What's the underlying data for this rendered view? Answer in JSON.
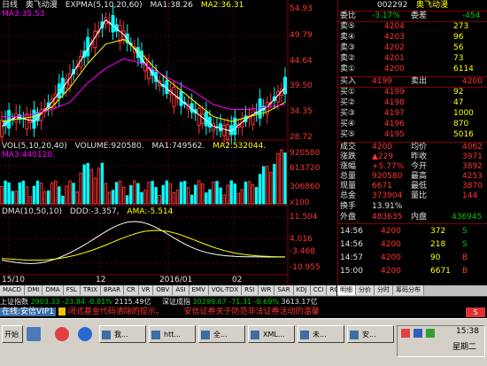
{
  "chart": {
    "stock_prefix": "日线",
    "stock_name": "奥飞动漫",
    "expma_label": "EXPMA(5,10,20,60)",
    "ma1": "MA1:38.26",
    "ma2": "MA2:36.31",
    "ma3": "MA3:35.53",
    "price_ticks": [
      "54.93",
      "49.79",
      "44.64",
      "39.50",
      "34.35",
      "28.72"
    ],
    "vol_label": "VOL(5,10,20,40)",
    "volume": "VOLUME:920580.",
    "vol_ma1": "MA1:749562.",
    "vol_ma2": "MA2:532044.",
    "vol_ma3": "MA3:440120.",
    "vol_ticks": [
      "920580",
      "613720",
      "306860",
      "x100"
    ],
    "dma_label": "DMA(10,50,10)",
    "ddd": "DDD:-3.357,",
    "ama": "AMA:-5.514",
    "dma_ticks": [
      "11.504",
      "4.016",
      "-3.468",
      "-10.955"
    ],
    "date_labels": [
      "15/10",
      "12",
      "2016/01",
      "02"
    ]
  },
  "chart_data": {
    "type": "line",
    "title": "",
    "xlabel": "",
    "ylabel": "",
    "ylim": [
      28.72,
      54.93
    ],
    "x": [
      1,
      5,
      10,
      15,
      20,
      25,
      30,
      35,
      40,
      45,
      50,
      55,
      60,
      65,
      70,
      75,
      80
    ],
    "series": [
      {
        "values": [
          31,
          33,
          32,
          36,
          41,
          47,
          53,
          50,
          45,
          40,
          37,
          34,
          31,
          30,
          33,
          35,
          39
        ]
      },
      {
        "values": [
          32,
          32.5,
          33,
          35,
          39,
          44,
          48,
          49,
          46,
          42,
          39,
          36,
          33,
          32,
          33,
          34,
          36
        ]
      },
      {
        "values": [
          33,
          33,
          33.5,
          34.5,
          36,
          40,
          43,
          45,
          44,
          42,
          40,
          38,
          35.5,
          34.5,
          34.5,
          35,
          35.5
        ]
      }
    ]
  },
  "quote": {
    "code": "002292",
    "name": "奥飞动漫",
    "weibi_label": "委比",
    "weibi": "-3.17%",
    "weicha_label": "委差",
    "weicha": "-454",
    "sells": [
      {
        "label": "卖⑤",
        "price": "4204",
        "vol": "273"
      },
      {
        "label": "卖④",
        "price": "4203",
        "vol": "96"
      },
      {
        "label": "卖③",
        "price": "4202",
        "vol": "56"
      },
      {
        "label": "卖②",
        "price": "4201",
        "vol": "73"
      },
      {
        "label": "卖①",
        "price": "4200",
        "vol": "6114"
      }
    ],
    "buy_in_label": "买入",
    "buy_in": "4199",
    "sell_out_label": "卖出",
    "sell_out": "4200",
    "buys": [
      {
        "label": "买①",
        "price": "4199",
        "vol": "92"
      },
      {
        "label": "买②",
        "price": "4198",
        "vol": "47"
      },
      {
        "label": "买③",
        "price": "4197",
        "vol": "1000"
      },
      {
        "label": "买④",
        "price": "4196",
        "vol": "870"
      },
      {
        "label": "买⑤",
        "price": "4195",
        "vol": "5016"
      }
    ],
    "stats": [
      {
        "l1": "成交",
        "v1": "4200",
        "l2": "均价",
        "v2": "4062"
      },
      {
        "l1": "涨跌",
        "v1": "▲229",
        "l2": "昨收",
        "v2": "3971"
      },
      {
        "l1": "涨幅",
        "v1": "+5.77%",
        "l2": "今开",
        "v2": "3892"
      },
      {
        "l1": "总量",
        "v1": "920580",
        "l2": "最高",
        "v2": "4253"
      },
      {
        "l1": "现量",
        "v1": "6671",
        "l2": "最低",
        "v2": "3870"
      },
      {
        "l1": "总金",
        "v1": "373904",
        "l2": "量比",
        "v2": "144"
      }
    ],
    "turnover_label": "换手",
    "turnover": "13.91%",
    "outer_label": "外盘",
    "outer": "483635",
    "inner_label": "内盘",
    "inner": "436945",
    "trades": [
      {
        "time": "14:56",
        "price": "4200",
        "vol": "372",
        "dir": "S"
      },
      {
        "time": "14:56",
        "price": "4200",
        "vol": "218",
        "dir": "S"
      },
      {
        "time": "14:57",
        "price": "4200",
        "vol": "90",
        "dir": "B"
      },
      {
        "time": "15:00",
        "price": "4200",
        "vol": "6671",
        "dir": "B"
      }
    ]
  },
  "tabs": [
    "MACD",
    "DMI",
    "DMA",
    "FSL",
    "TRIX",
    "BRAR",
    "CR",
    "VR",
    "OBV",
    "ASI",
    "EMV",
    "VOL-TDX",
    "RSI",
    "WR",
    "SAR",
    "KDJ",
    "CCI",
    "ROC",
    "MTM"
  ],
  "right_tabs": [
    "明细",
    "分价",
    "分时",
    "筹码分布"
  ],
  "index_bar": {
    "l1": "上证指数",
    "v1": "2903.33",
    "c1": "-23.84",
    "p1": "-0.81%",
    "a1": "2115.49亿",
    "l2": "深证成指",
    "v2": "10299.67",
    "c2": "-71.31",
    "p2": "-0.69%",
    "a2": "3613.17亿"
  },
  "ticker": {
    "online": "在线:安信VIP1",
    "msg1": "闭式基金代码清除的提示。",
    "msg2": "安信证券关于防范非法证券活动的温馨"
  },
  "taskbar": {
    "start": "开始",
    "buttons": [
      "我...",
      "htt...",
      "全...",
      "XML...",
      "未...",
      "安..."
    ],
    "time": "15:38",
    "weekday": "星期二"
  }
}
